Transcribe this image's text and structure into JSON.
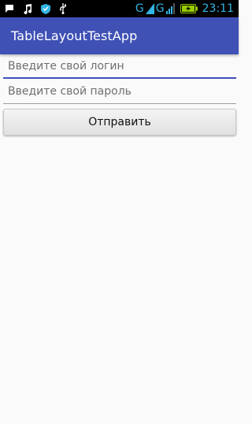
{
  "status_bar": {
    "left_icons": [
      "message-icon",
      "music-note-icon",
      "shield-app-icon",
      "usb-icon"
    ],
    "network_label_1": "G",
    "network_label_2": "G",
    "clock": "23:11",
    "accent_color": "#33b5e5"
  },
  "app_bar": {
    "title": "TableLayoutTestApp",
    "color": "#3f51b5"
  },
  "form": {
    "login_placeholder": "Введите свой логин",
    "password_placeholder": "Введите свой пароль",
    "submit_label": "Отправить"
  }
}
